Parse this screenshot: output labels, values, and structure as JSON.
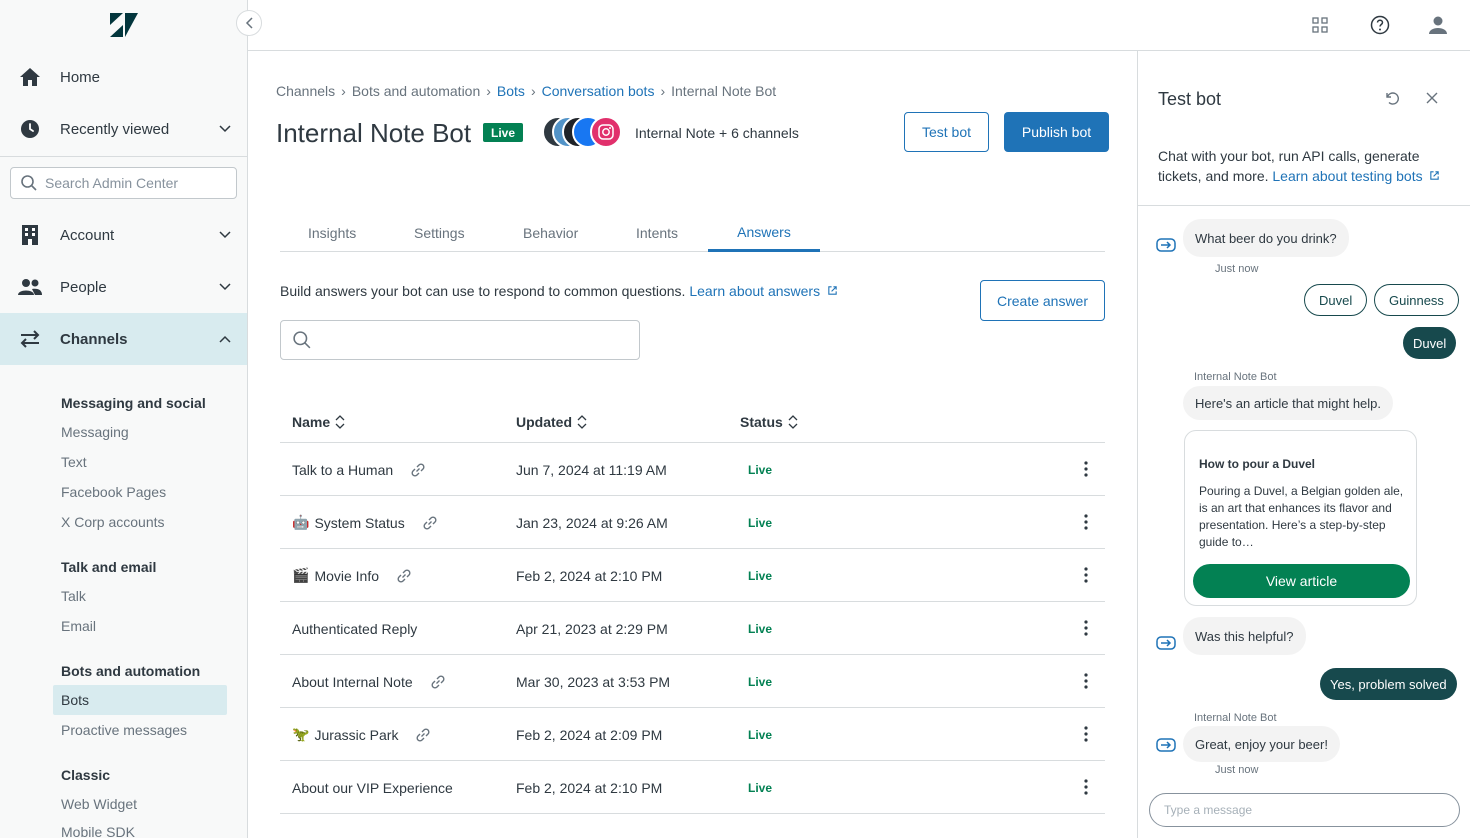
{
  "sidebar": {
    "home_label": "Home",
    "recent_label": "Recently viewed",
    "search_placeholder": "Search Admin Center",
    "account_label": "Account",
    "people_label": "People",
    "channels_label": "Channels",
    "groups": [
      {
        "heading": "Messaging and social",
        "items": [
          "Messaging",
          "Text",
          "Facebook Pages",
          "X Corp accounts"
        ]
      },
      {
        "heading": "Talk and email",
        "items": [
          "Talk",
          "Email"
        ]
      },
      {
        "heading": "Bots and automation",
        "items": [
          "Bots",
          "Proactive messages"
        ]
      },
      {
        "heading": "Classic",
        "items": [
          "Web Widget",
          "Mobile SDK"
        ]
      }
    ],
    "selected_item": "Bots"
  },
  "breadcrumb": {
    "items": [
      "Channels",
      "Bots and automation",
      "Bots",
      "Conversation bots",
      "Internal Note Bot"
    ]
  },
  "page": {
    "title": "Internal Note Bot",
    "status_badge": "Live",
    "channels_text": "Internal Note + 6 channels",
    "test_bot_label": "Test bot",
    "publish_bot_label": "Publish bot"
  },
  "tabs": [
    "Insights",
    "Settings",
    "Behavior",
    "Intents",
    "Answers"
  ],
  "active_tab": "Answers",
  "answers": {
    "description": "Build answers your bot can use to respond to common questions.",
    "learn_link": "Learn about answers",
    "create_label": "Create answer",
    "search_value": ""
  },
  "table": {
    "headers": [
      "Name",
      "Updated",
      "Status"
    ],
    "rows": [
      {
        "emoji": "",
        "name": "Talk to a Human",
        "linked": true,
        "updated": "Jun 7, 2024 at 11:19 AM",
        "status": "Live"
      },
      {
        "emoji": "🤖",
        "name": "System Status",
        "linked": true,
        "updated": "Jan 23, 2024 at 9:26 AM",
        "status": "Live"
      },
      {
        "emoji": "🎬",
        "name": "Movie Info",
        "linked": true,
        "updated": "Feb 2, 2024 at 2:10 PM",
        "status": "Live"
      },
      {
        "emoji": "",
        "name": "Authenticated Reply",
        "linked": false,
        "updated": "Apr 21, 2023 at 2:29 PM",
        "status": "Live"
      },
      {
        "emoji": "",
        "name": "About Internal Note",
        "linked": true,
        "updated": "Mar 30, 2023 at 3:53 PM",
        "status": "Live"
      },
      {
        "emoji": "🦖",
        "name": "Jurassic Park",
        "linked": true,
        "updated": "Feb 2, 2024 at 2:09 PM",
        "status": "Live"
      },
      {
        "emoji": "",
        "name": "About our VIP Experience",
        "linked": false,
        "updated": "Feb 2, 2024 at 2:10 PM",
        "status": "Live"
      }
    ]
  },
  "test_panel": {
    "title": "Test bot",
    "description": "Chat with your bot, run API calls, generate tickets, and more.",
    "learn_link": "Learn about testing bots",
    "messages": {
      "bot_q1": "What beer do you drink?",
      "just_now": "Just now",
      "chip_duvel": "Duvel",
      "chip_guinness": "Guinness",
      "user_duvel": "Duvel",
      "bot_name": "Internal Note Bot",
      "bot_article_intro": "Here's an article that might help.",
      "article_title": "How to pour a Duvel",
      "article_body": "Pouring a Duvel, a Belgian golden ale, is an art that enhances its flavor and presentation. Here’s a step-by-step guide to…",
      "view_article": "View article",
      "bot_helpful": "Was this helpful?",
      "user_solved": "Yes, problem solved",
      "bot_enjoy": "Great, enjoy your beer!"
    },
    "input_placeholder": "Type a message"
  },
  "colors": {
    "accent": "#1f73b7",
    "live_green": "#038153",
    "user_bubble": "#17494d",
    "sidebar_active": "#d8ebef"
  }
}
